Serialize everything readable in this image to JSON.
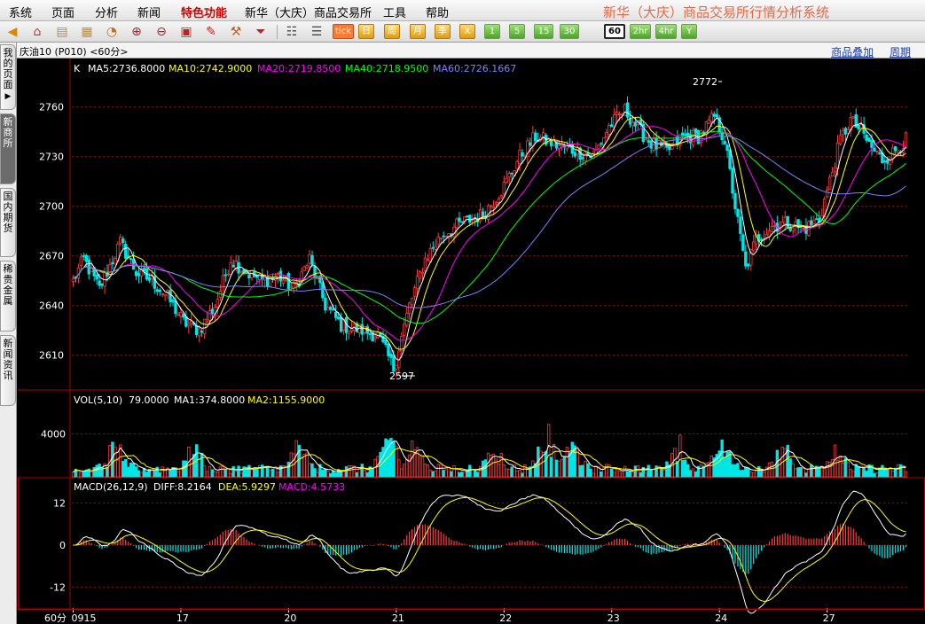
{
  "menu": {
    "items": [
      "系统",
      "页面",
      "分析",
      "新闻",
      "特色功能",
      "新华（大庆）商品交易所",
      "工具",
      "帮助"
    ],
    "active_index": 4,
    "app_title": "新华（大庆）商品交易所行情分析系统"
  },
  "toolbar": {
    "period_buttons": [
      "日",
      "周",
      "月",
      "季",
      "X",
      "1",
      "5",
      "15",
      "30",
      "60",
      "2hr",
      "4hr",
      "Y"
    ],
    "selected_period": "60",
    "tick_label": "tick"
  },
  "subbar": {
    "contract": "庆油10 (P010) <60分>",
    "links": [
      "商品叠加",
      "周期"
    ]
  },
  "side_tabs": [
    "我的页面",
    "新商所",
    "国内期货",
    "稀贵金属",
    "新闻资讯"
  ],
  "side_tabs_active": 1,
  "colors": {
    "up": "#ff3c3c",
    "down": "#00e6e6",
    "ma5": "#ffffff",
    "ma10": "#ffff00",
    "ma20": "#ff00ff",
    "ma40": "#00ff00",
    "ma60": "#8080ff",
    "grid": "#8a1010",
    "border": "#b00000"
  },
  "legend": {
    "k_label": "K",
    "ma5": "MA5:2736.8000",
    "ma10": "MA10:2742.9000",
    "ma20": "MA20:2719.8500",
    "ma40": "MA40:2718.9500",
    "ma60": "MA60:2726.1667",
    "vol_label": "VOL(5,10)",
    "vol_value": "79.0000",
    "vol_ma1": "MA1:374.8000",
    "vol_ma2": "MA2:1155.9000",
    "macd_label": "MACD(26,12,9)",
    "diff": "DIFF:8.2164",
    "dea": "DEA:5.9297",
    "macd": "MACD:4.5733"
  },
  "chart_data": {
    "type": "candlestick",
    "price_axis": {
      "ticks": [
        2610,
        2640,
        2670,
        2700,
        2730,
        2760
      ],
      "range": [
        2590,
        2778
      ]
    },
    "high_marker": {
      "value": 2772,
      "label": "2772"
    },
    "low_marker": {
      "value": 2597,
      "label": "2597"
    },
    "volume_axis": {
      "ticks": [
        4000
      ],
      "range": [
        0,
        7500
      ]
    },
    "macd_axis": {
      "ticks": [
        12,
        0,
        -12
      ],
      "range": [
        -18,
        18
      ]
    },
    "x_axis": {
      "period_label": "60分",
      "labels": [
        {
          "text": "0915",
          "index": 0
        },
        {
          "text": "17",
          "index": 41
        },
        {
          "text": "20",
          "index": 82
        },
        {
          "text": "21",
          "index": 123
        },
        {
          "text": "22",
          "index": 164
        },
        {
          "text": "23",
          "index": 205
        },
        {
          "text": "24",
          "index": 246
        },
        {
          "text": "27",
          "index": 287
        }
      ]
    },
    "anchors": [
      [
        0,
        2655
      ],
      [
        4,
        2668
      ],
      [
        10,
        2650
      ],
      [
        18,
        2678
      ],
      [
        24,
        2660
      ],
      [
        30,
        2655
      ],
      [
        36,
        2645
      ],
      [
        42,
        2630
      ],
      [
        48,
        2625
      ],
      [
        54,
        2640
      ],
      [
        60,
        2668
      ],
      [
        66,
        2660
      ],
      [
        72,
        2655
      ],
      [
        78,
        2658
      ],
      [
        84,
        2650
      ],
      [
        90,
        2668
      ],
      [
        96,
        2640
      ],
      [
        102,
        2628
      ],
      [
        110,
        2625
      ],
      [
        116,
        2622
      ],
      [
        122,
        2602
      ],
      [
        128,
        2640
      ],
      [
        134,
        2668
      ],
      [
        140,
        2682
      ],
      [
        148,
        2690
      ],
      [
        156,
        2695
      ],
      [
        164,
        2712
      ],
      [
        170,
        2730
      ],
      [
        176,
        2742
      ],
      [
        184,
        2737
      ],
      [
        192,
        2733
      ],
      [
        198,
        2730
      ],
      [
        204,
        2748
      ],
      [
        210,
        2758
      ],
      [
        216,
        2745
      ],
      [
        220,
        2738
      ],
      [
        226,
        2733
      ],
      [
        232,
        2742
      ],
      [
        238,
        2742
      ],
      [
        244,
        2754
      ],
      [
        248,
        2740
      ],
      [
        252,
        2700
      ],
      [
        256,
        2662
      ],
      [
        260,
        2680
      ],
      [
        266,
        2688
      ],
      [
        272,
        2690
      ],
      [
        278,
        2686
      ],
      [
        284,
        2692
      ],
      [
        288,
        2715
      ],
      [
        292,
        2740
      ],
      [
        296,
        2752
      ],
      [
        300,
        2745
      ],
      [
        304,
        2735
      ],
      [
        308,
        2728
      ],
      [
        312,
        2732
      ],
      [
        317,
        2740
      ]
    ],
    "volume_peaks": [
      [
        16,
        2200
      ],
      [
        46,
        2200
      ],
      [
        86,
        2400
      ],
      [
        120,
        3200
      ],
      [
        130,
        2500
      ],
      [
        160,
        2200
      ],
      [
        180,
        3700
      ],
      [
        190,
        2200
      ],
      [
        230,
        2600
      ],
      [
        247,
        2600
      ],
      [
        270,
        2200
      ],
      [
        290,
        2300
      ]
    ]
  }
}
